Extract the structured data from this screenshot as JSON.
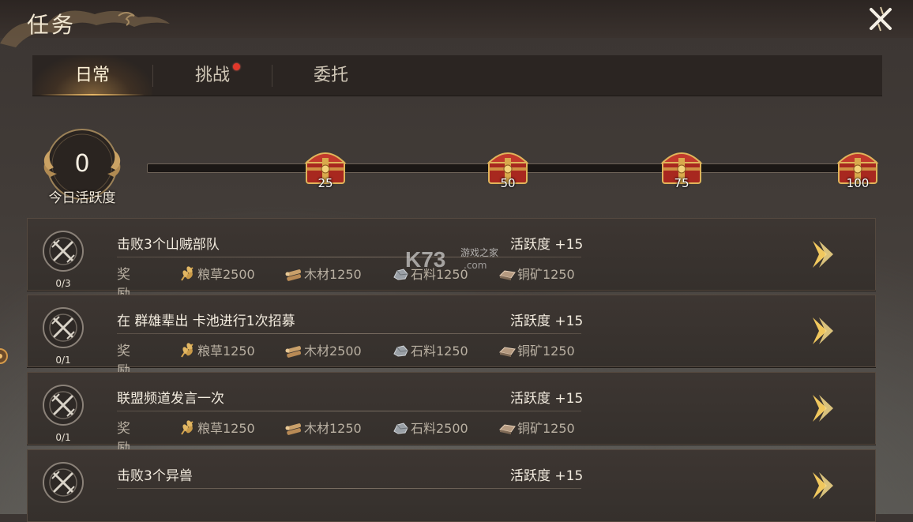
{
  "header": {
    "title": "任务"
  },
  "tabs": [
    {
      "label": "日常",
      "active": true,
      "badge": false
    },
    {
      "label": "挑战",
      "active": false,
      "badge": true
    },
    {
      "label": "委托",
      "active": false,
      "badge": false
    }
  ],
  "activity": {
    "value": "0",
    "label": "今日活跃度",
    "progress_fraction": 0
  },
  "chests": [
    {
      "label": "25"
    },
    {
      "label": "50"
    },
    {
      "label": "75"
    },
    {
      "label": "100"
    }
  ],
  "reward_label": "奖励",
  "tasks": [
    {
      "title": "击败3个山贼部队",
      "count": "0/3",
      "points": "活跃度 +15",
      "rewards": [
        {
          "icon": "grain-icon",
          "text": "粮草2500"
        },
        {
          "icon": "wood-icon",
          "text": "木材1250"
        },
        {
          "icon": "stone-icon",
          "text": "石料1250"
        },
        {
          "icon": "copper-icon",
          "text": "铜矿1250"
        }
      ]
    },
    {
      "title": "在 群雄辈出 卡池进行1次招募",
      "count": "0/1",
      "points": "活跃度 +15",
      "rewards": [
        {
          "icon": "grain-icon",
          "text": "粮草1250"
        },
        {
          "icon": "wood-icon",
          "text": "木材2500"
        },
        {
          "icon": "stone-icon",
          "text": "石料1250"
        },
        {
          "icon": "copper-icon",
          "text": "铜矿1250"
        }
      ]
    },
    {
      "title": "联盟频道发言一次",
      "count": "0/1",
      "points": "活跃度 +15",
      "rewards": [
        {
          "icon": "grain-icon",
          "text": "粮草1250"
        },
        {
          "icon": "wood-icon",
          "text": "木材1250"
        },
        {
          "icon": "stone-icon",
          "text": "石料2500"
        },
        {
          "icon": "copper-icon",
          "text": "铜矿1250"
        }
      ]
    },
    {
      "title": "击败3个异兽",
      "count": "",
      "points": "活跃度 +15",
      "rewards": []
    }
  ],
  "watermark": {
    "brand": "K73",
    "text": "游戏之家",
    "domain": ".com"
  },
  "colors": {
    "accent_gold": "#e8b868",
    "badge_red": "#e2372a",
    "chest_red": "#b8322a"
  }
}
